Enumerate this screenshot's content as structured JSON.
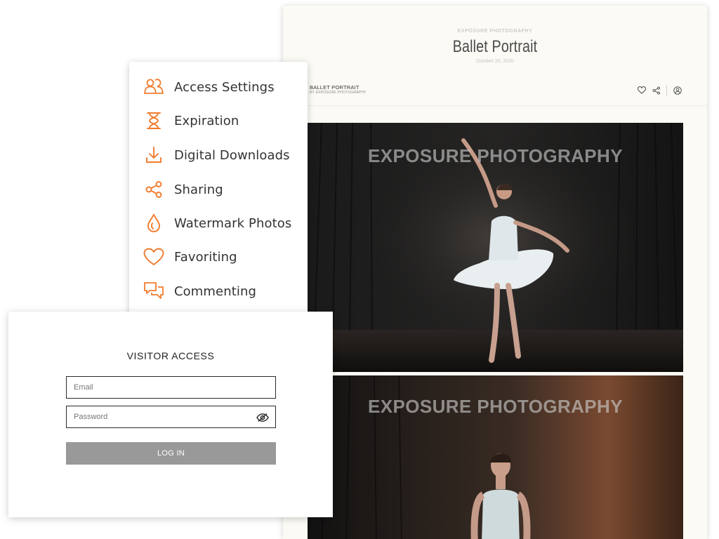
{
  "gallery": {
    "subtitle": "EXPOSURE PHOTOGRAPHY",
    "title": "Ballet Portrait",
    "date": "October 20, 2020",
    "brand_name": "BALLET PORTRAIT",
    "brand_by": "BY EXPOSURE PHOTOGRAPHY",
    "icons": [
      "heart-icon",
      "share-icon",
      "user-icon"
    ],
    "watermark": "EXPOSURE PHOTOGRAPHY"
  },
  "menu": {
    "accent_color": "#f07b2e",
    "items": [
      {
        "label": "Access Settings",
        "icon": "users-icon"
      },
      {
        "label": "Expiration",
        "icon": "hourglass-icon"
      },
      {
        "label": "Digital Downloads",
        "icon": "download-icon"
      },
      {
        "label": "Sharing",
        "icon": "share-icon"
      },
      {
        "label": "Watermark Photos",
        "icon": "drop-icon"
      },
      {
        "label": "Favoriting",
        "icon": "heart-icon"
      },
      {
        "label": "Commenting",
        "icon": "chat-icon"
      }
    ]
  },
  "login": {
    "title": "VISITOR ACCESS",
    "email_placeholder": "Email",
    "password_placeholder": "Password",
    "button_label": "LOG IN"
  }
}
